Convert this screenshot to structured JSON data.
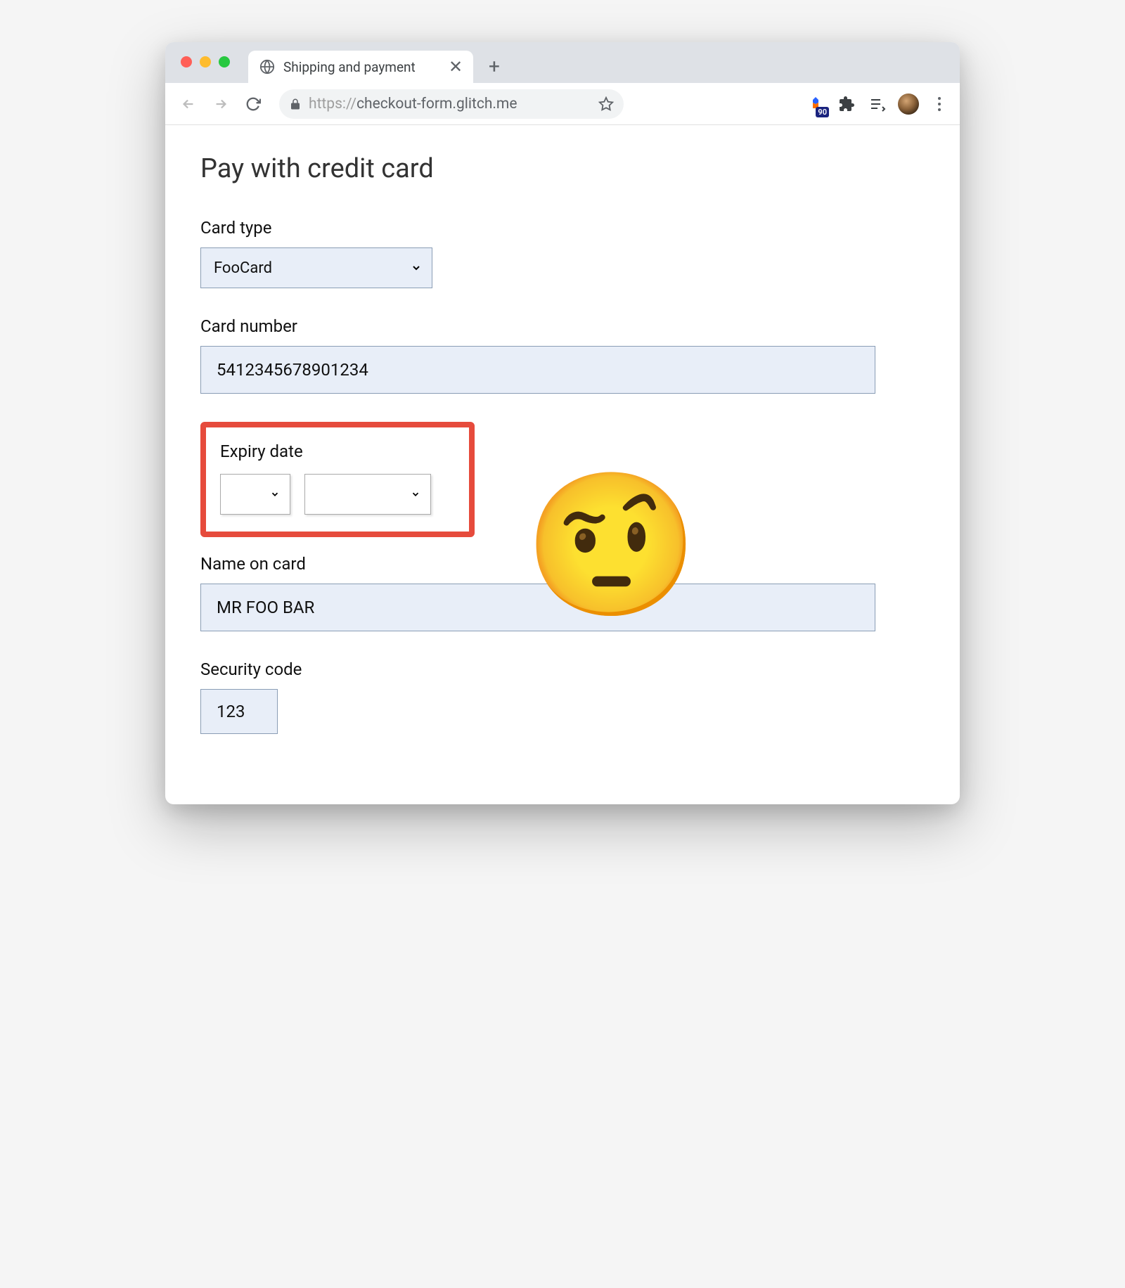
{
  "browser": {
    "tab_title": "Shipping and payment",
    "url_scheme": "https://",
    "url_rest": "checkout-form.glitch.me",
    "lighthouse_score": "90"
  },
  "page": {
    "title": "Pay with credit card",
    "emoji": "🤨",
    "fields": {
      "card_type": {
        "label": "Card type",
        "value": "FooCard"
      },
      "card_number": {
        "label": "Card number",
        "value": "5412345678901234"
      },
      "expiry": {
        "label": "Expiry date",
        "month": "",
        "year": ""
      },
      "name_on_card": {
        "label": "Name on card",
        "value": "MR FOO BAR"
      },
      "security_code": {
        "label": "Security code",
        "value": "123"
      }
    }
  }
}
